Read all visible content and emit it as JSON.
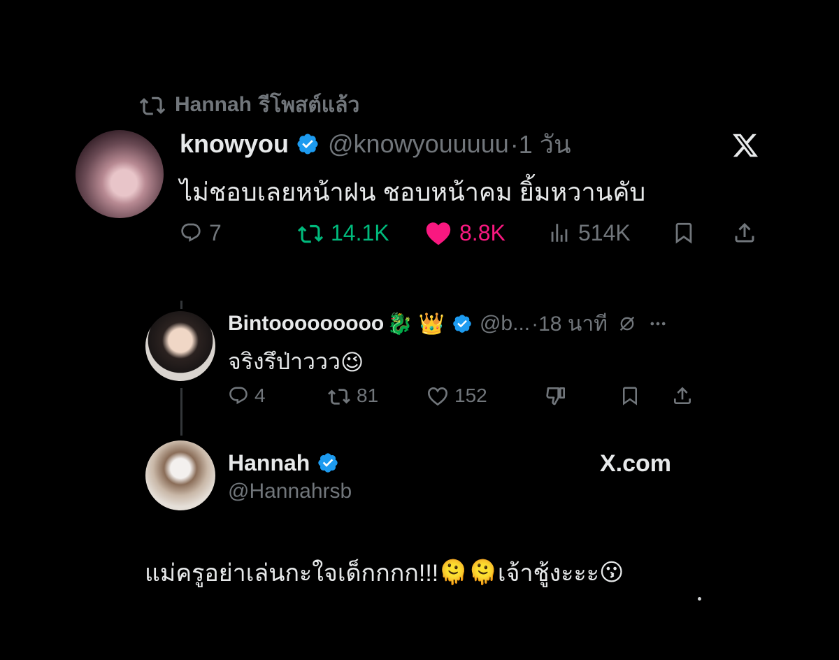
{
  "repost_banner": {
    "user": "Hannah",
    "suffix": "รีโพสต์แล้ว"
  },
  "main_tweet": {
    "name": "knowyou",
    "handle": "@knowyouuuuu",
    "time": "·1 วัน",
    "text": "ไม่ชอบเลยหน้าฝน ชอบหน้าคม ยิ้มหวานคับ",
    "replies": "7",
    "reposts": "14.1K",
    "likes": "8.8K",
    "views": "514K"
  },
  "reply_tweet": {
    "name": "Bintooooooooo",
    "name_emojis": [
      "🐉",
      "👑"
    ],
    "handle": "@b...",
    "time": "·18 นาที",
    "text": "จริงรึป่าววว",
    "text_emoji": "😉",
    "replies": "4",
    "reposts": "81",
    "likes": "152"
  },
  "hannah_card": {
    "name": "Hannah",
    "handle": "@Hannahrsb",
    "site": "X.com",
    "text_part1": "แม่ครูอย่าเล่นกะใจเด็กกกก!!!",
    "emoji1": "🫠",
    "emoji2": "🫠",
    "text_part2": "เจ้าชู้งะะะ",
    "emoji3": "😗"
  },
  "colors": {
    "background": "#000000",
    "text": "#e7e9ea",
    "secondary": "#71767b",
    "verified": "#1d9bf0",
    "repost_green": "#00ba7c",
    "like_pink": "#f91880"
  },
  "icons": [
    "repost-icon",
    "verified-badge-icon",
    "x-logo-icon",
    "reply-icon",
    "heart-icon",
    "views-icon",
    "bookmark-icon",
    "share-icon",
    "grok-icon",
    "more-icon",
    "dislike-icon"
  ]
}
